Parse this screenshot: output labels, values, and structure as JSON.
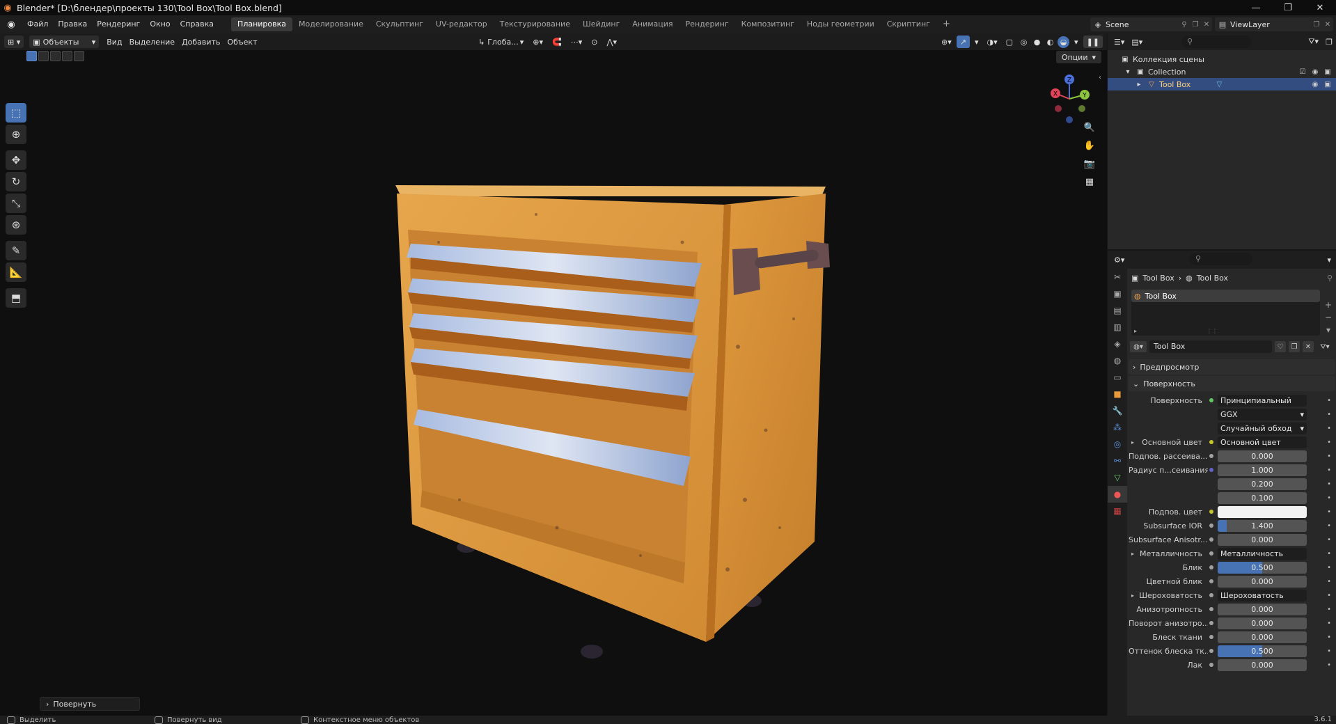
{
  "window": {
    "title": "Blender* [D:\\блендер\\проекты 130\\Tool Box\\Tool Box.blend]",
    "minimize": "—",
    "maximize": "❐",
    "close": "✕"
  },
  "menu": {
    "items": [
      "Файл",
      "Правка",
      "Рендеринг",
      "Окно",
      "Справка"
    ]
  },
  "workspaces": {
    "tabs": [
      "Планировка",
      "Моделирование",
      "Скульптинг",
      "UV-редактор",
      "Текстурирование",
      "Шейдинг",
      "Анимация",
      "Рендеринг",
      "Композитинг",
      "Ноды геометрии",
      "Скриптинг"
    ],
    "active": "Планировка",
    "add": "+"
  },
  "scene": {
    "name": "Scene"
  },
  "view_layer": {
    "name": "ViewLayer"
  },
  "viewport": {
    "mode": "Объекты",
    "menus": [
      "Вид",
      "Выделение",
      "Добавить",
      "Объект"
    ],
    "orientation": "Глоба...",
    "options": "Опции",
    "last_operator": "Повернуть"
  },
  "gizmo": {
    "x": "X",
    "y": "Y",
    "z": "Z"
  },
  "icons": {
    "tools": [
      "select-box-icon",
      "cursor-icon",
      "move-icon",
      "rotate-icon",
      "scale-icon",
      "transform-icon",
      "annotate-icon",
      "measure-icon",
      "add-cube-icon"
    ],
    "nav": [
      "zoom-icon",
      "hand-pan-icon",
      "camera-icon",
      "grid-icon"
    ]
  },
  "outliner": {
    "root": "Коллекция сцены",
    "collection": "Collection",
    "object": "Tool Box"
  },
  "properties": {
    "breadcrumb_object": "Tool Box",
    "breadcrumb_material": "Tool Box",
    "slot": "Tool Box",
    "material_name": "Tool Box",
    "panels": {
      "preview": "Предпросмотр",
      "surface": "Поверхность"
    },
    "rows": [
      {
        "label": "Поверхность",
        "value": "Принципиальный BSDF",
        "kind": "link",
        "socket": "#63c763"
      },
      {
        "label": "",
        "value": "GGX",
        "kind": "drop"
      },
      {
        "label": "",
        "value": "Случайный обход",
        "kind": "drop"
      },
      {
        "label": "Основной цвет",
        "value": "Основной цвет",
        "kind": "link",
        "socket": "#c7c729",
        "expand": true
      },
      {
        "label": "Подпов. рассеива...",
        "value": "0.000",
        "kind": "num",
        "socket": "#a1a1a1"
      },
      {
        "label": "Радиус п...сеивания",
        "value": "1.000",
        "kind": "num",
        "socket": "#6363c7"
      },
      {
        "label": "",
        "value": "0.200",
        "kind": "num"
      },
      {
        "label": "",
        "value": "0.100",
        "kind": "num"
      },
      {
        "label": "Подпов. цвет",
        "value": "",
        "kind": "color",
        "socket": "#c7c729"
      },
      {
        "label": "Subsurface IOR",
        "value": "1.400",
        "kind": "num",
        "fill": 0.1,
        "socket": "#a1a1a1"
      },
      {
        "label": "Subsurface Anisotr...",
        "value": "0.000",
        "kind": "num",
        "socket": "#a1a1a1"
      },
      {
        "label": "Металличность",
        "value": "Металличность",
        "kind": "link",
        "socket": "#a1a1a1",
        "expand": true
      },
      {
        "label": "Блик",
        "value": "0.500",
        "kind": "num",
        "fill": 0.5,
        "socket": "#a1a1a1"
      },
      {
        "label": "Цветной блик",
        "value": "0.000",
        "kind": "num",
        "socket": "#a1a1a1"
      },
      {
        "label": "Шероховатость",
        "value": "Шероховатость",
        "kind": "link",
        "socket": "#a1a1a1",
        "expand": true
      },
      {
        "label": "Анизотропность",
        "value": "0.000",
        "kind": "num",
        "socket": "#a1a1a1"
      },
      {
        "label": "Поворот анизотро...",
        "value": "0.000",
        "kind": "num",
        "socket": "#a1a1a1"
      },
      {
        "label": "Блеск ткани",
        "value": "0.000",
        "kind": "num",
        "socket": "#a1a1a1"
      },
      {
        "label": "Оттенок блеска тк...",
        "value": "0.500",
        "kind": "num",
        "fill": 0.5,
        "socket": "#a1a1a1"
      },
      {
        "label": "Лак",
        "value": "0.000",
        "kind": "num",
        "socket": "#a1a1a1"
      }
    ]
  },
  "statusbar": {
    "left": "Выделить",
    "middle": "Повернуть вид",
    "right": "Контекстное меню объектов",
    "version": "3.6.1"
  },
  "colors": {
    "accent": "#4772b3",
    "selected_row": "#334d80",
    "toolbox_orange": "#e29a3a",
    "drawer_steel": "#9eb2d6"
  }
}
